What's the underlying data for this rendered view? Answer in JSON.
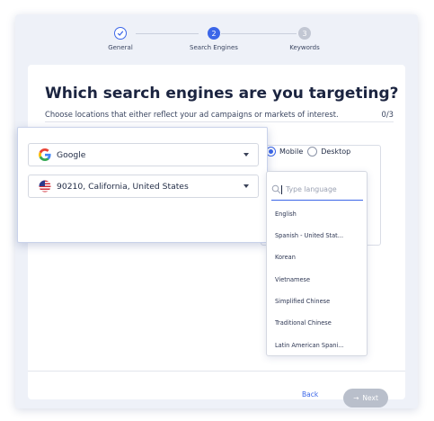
{
  "stepper": {
    "steps": [
      {
        "label": "General",
        "marker": "",
        "state": "done"
      },
      {
        "label": "Search Engines",
        "marker": "2",
        "state": "active"
      },
      {
        "label": "Keywords",
        "marker": "3",
        "state": "pending"
      }
    ]
  },
  "main": {
    "title": "Which search engines are you targeting?",
    "subtitle": "Choose locations that either reflect your ad campaigns or markets of interest.",
    "counter": "0/3"
  },
  "engine_select": {
    "value": "Google",
    "icon": "google-logo-icon"
  },
  "location_select": {
    "value": "90210, California, United States",
    "icon": "us-flag-icon"
  },
  "device": {
    "mobile_label": "Mobile",
    "desktop_label": "Desktop",
    "selected": "Mobile"
  },
  "language_dropdown": {
    "placeholder": "Type language",
    "options": [
      "English",
      "Spanish - United Stat...",
      "Korean",
      "Vietnamese",
      "Simplified Chinese",
      "Traditional Chinese",
      "Latin American Spani..."
    ]
  },
  "footer": {
    "back_label": "Back",
    "next_label": "Next",
    "next_arrow": "→"
  },
  "colors": {
    "accent": "#3b66e8",
    "disabled": "#b9bfcb",
    "background": "#eef1f8"
  }
}
